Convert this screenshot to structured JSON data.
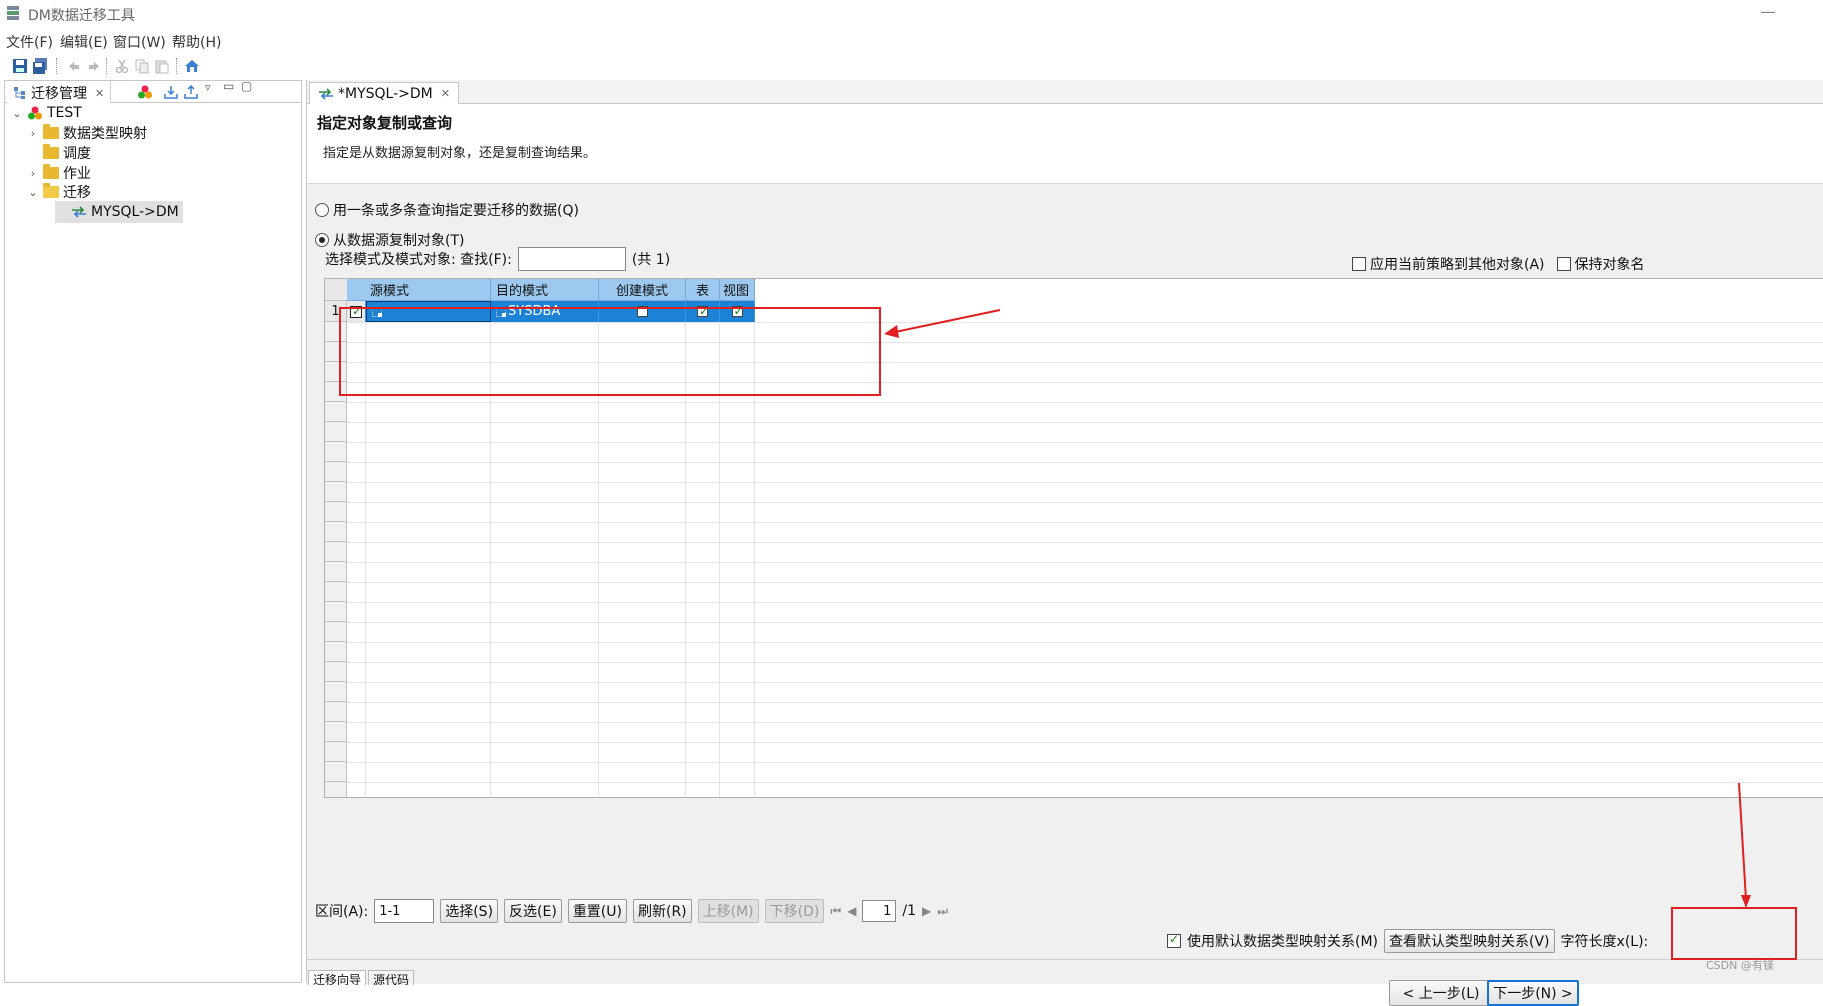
{
  "window": {
    "title": "DM数据迁移工具"
  },
  "menu": [
    "文件(F)",
    "编辑(E)",
    "窗口(W)",
    "帮助(H)"
  ],
  "left_panel": {
    "tab_label": "迁移管理",
    "tree": [
      {
        "label": "TEST",
        "level": 0,
        "arrow": "⌄"
      },
      {
        "label": "数据类型映射",
        "level": 1,
        "arrow": "›"
      },
      {
        "label": "调度",
        "level": 1,
        "arrow": ""
      },
      {
        "label": "作业",
        "level": 1,
        "arrow": "›"
      },
      {
        "label": "迁移",
        "level": 1,
        "arrow": "⌄"
      },
      {
        "label": "MYSQL->DM",
        "level": 2,
        "arrow": ""
      }
    ]
  },
  "editor": {
    "tab_label": "*MYSQL->DM",
    "title": "指定对象复制或查询",
    "description": "指定是从数据源复制对象，还是复制查询结果。",
    "option_query": "用一条或多条查询指定要迁移的数据(Q)",
    "option_copy": "从数据源复制对象(T)",
    "filter_label": "选择模式及模式对象: 查找(F):",
    "filter_value": "",
    "count_label": "(共 1)",
    "apply_policy": "应用当前策略到其他对象(A)",
    "keep_name": "保持对象名",
    "table": {
      "columns": [
        "源模式",
        "目的模式",
        "创建模式",
        "表",
        "视图"
      ],
      "rows": [
        {
          "num": "1",
          "selected": true,
          "source": "",
          "target": "SYSDBA",
          "create_schema": false,
          "table": true,
          "view": true
        }
      ]
    },
    "range_label": "区间(A):",
    "range_value": "1-1",
    "buttons": {
      "select": "选择(S)",
      "invert": "反选(E)",
      "reset": "重置(U)",
      "refresh": "刷新(R)",
      "move_up": "上移(M)",
      "move_down": "下移(D)"
    },
    "page_value": "1",
    "page_total": "/1",
    "use_default_mapping": "使用默认数据类型映射关系(M)",
    "view_default_mapping": "查看默认类型映射关系(V)",
    "char_length": "字符长度x(L):",
    "prev": "< 上一步(L)",
    "next": "下一步(N) >"
  },
  "bottom_tabs": [
    "迁移向导",
    "源代码"
  ],
  "watermark": "CSDN @有镁"
}
